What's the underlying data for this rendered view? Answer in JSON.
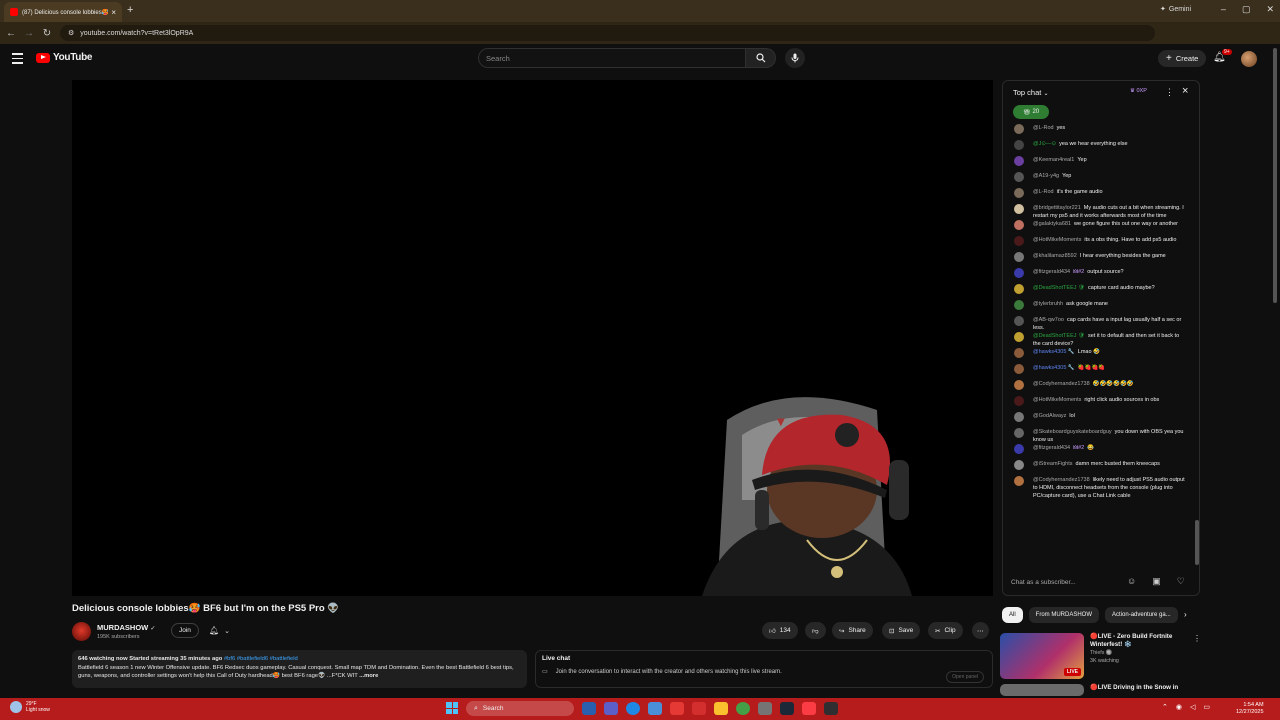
{
  "browser": {
    "tab_title": "(87) Delicious console lobbies🥵",
    "url": "youtube.com/watch?v=tRet3lOpR9A",
    "gemini_label": "Gemini"
  },
  "header": {
    "logo_text": "YouTube",
    "search_placeholder": "Search",
    "create_label": "Create",
    "notifications_count": "9+"
  },
  "video": {
    "title": "Delicious console lobbies🥵 BF6 but I'm on the PS5 Pro 👽",
    "channel_name": "MURDASHOW",
    "verified_icon": "verified-check",
    "subscribers": "195K subscribers",
    "join_label": "Join",
    "likes": "134",
    "share_label": "Share",
    "save_label": "Save",
    "clip_label": "Clip"
  },
  "description": {
    "meta": "646 watching now  Started streaming 35 minutes ago",
    "tags": "#bf6 #battlefield6 #battlefield",
    "text": "Battlefield 6 season 1 new Winter Offensive update. BF6 Redsec duos gameplay. Casual conquest. Small map TDM and Domination. Even the best Battlefield 6 best tips, guns, weapons, and controller settings won't help this Call of Duty hardhead🥵 best BF6 rage👽 ...F*CK WIT",
    "more_label": "...more"
  },
  "livechat_box": {
    "heading": "Live chat",
    "body": "Join the conversation to interact with the creator and others watching this live stream.",
    "open_button": "Open panel"
  },
  "chat": {
    "title": "Top chat",
    "xp_label": "0XP",
    "gift_count": "20",
    "input_placeholder": "Chat as a subscriber...",
    "messages": [
      {
        "author": "@L-Rod",
        "text": "yes",
        "type": "normal",
        "color": "#7a6a5a"
      },
      {
        "author": "@J⊙—⊙",
        "text": "yea we hear everything else",
        "type": "member",
        "color": "#444444"
      },
      {
        "author": "@Keeman4real1",
        "text": "Yep",
        "type": "normal",
        "color": "#6a3fa0"
      },
      {
        "author": "@A19-y4g",
        "text": "Yep",
        "type": "normal",
        "color": "#555555"
      },
      {
        "author": "@L-Rod",
        "text": "it's the game audio",
        "type": "normal",
        "color": "#7a6a5a"
      },
      {
        "author": "@bridgettitaylor221",
        "text": "My audio cuts out a bit when streaming. I restart my ps5 and it works afterwards most of the time",
        "type": "normal",
        "color": "#d0c0a0"
      },
      {
        "author": "@galaktyka681",
        "text": "we gone figure this out one way or another",
        "type": "normal",
        "color": "#c07060"
      },
      {
        "author": "@HotMikeMoments",
        "text": "its a obs thing. Have to add ps5 audio",
        "type": "normal",
        "color": "#4a1a1a"
      },
      {
        "author": "@khalilamaz8592",
        "text": "I hear everything besides the game",
        "type": "normal",
        "color": "#777777"
      },
      {
        "author": "@fitzgerald434",
        "badge": "🜲#2",
        "text": "output source?",
        "type": "normal",
        "color": "#3a3aaa"
      },
      {
        "author": "@DeadShotTEEJ 🛡",
        "text": "capture card audio maybe?",
        "type": "member",
        "color": "#c0a030"
      },
      {
        "author": "@tylerbruhh",
        "text": "ask google mane",
        "type": "normal",
        "color": "#3a7a3a"
      },
      {
        "author": "@AB-qw7oo",
        "text": "cap cards have a input lag usually half a sec or less.",
        "type": "normal",
        "color": "#555555"
      },
      {
        "author": "@DeadShotTEEJ 🛡",
        "text": "set it to default and then set it back to the card device?",
        "type": "member",
        "color": "#c0a030"
      },
      {
        "author": "@hawks4305 🔧",
        "text": "Lmao 🤣",
        "type": "mod",
        "color": "#8a5a3a"
      },
      {
        "author": "@hawks4305 🔧",
        "text": "🍓🍓🍓🍓",
        "type": "mod",
        "color": "#8a5a3a"
      },
      {
        "author": "@Codyhernandez1738",
        "text": "🤣🤣🤣🤣🤣🤣",
        "type": "normal",
        "color": "#b07040"
      },
      {
        "author": "@HotMikeMoments",
        "text": "right click audio sources in obs",
        "type": "normal",
        "color": "#4a1a1a"
      },
      {
        "author": "@GodAlwayz",
        "text": "lol",
        "type": "normal",
        "color": "#777777"
      },
      {
        "author": "@Skateboardguyskateboardguy",
        "text": "you down with OBS yea you know us",
        "type": "normal",
        "color": "#666666"
      },
      {
        "author": "@fitzgerald434",
        "badge": "🜲#2",
        "text": "😂",
        "type": "normal",
        "color": "#3a3aaa"
      },
      {
        "author": "@iStreamFights",
        "text": "damn merc busted them kneecaps",
        "type": "normal",
        "color": "#888888"
      },
      {
        "author": "@Codyhernandez1738",
        "text": "likely need to adjust PS5 audio output to HDMI, disconnect headsets from the console (plug into PC/capture card), use a Chat Link cable",
        "type": "normal",
        "color": "#b07040"
      }
    ]
  },
  "recommendations": {
    "chips": [
      "All",
      "From MURDASHOW",
      "Action-adventure ga..."
    ],
    "items": [
      {
        "title": "🔴LIVE - Zero Build Fortnite Winterfest! ❄️",
        "channel": "Thiefs 🔘",
        "stats": "3K watching",
        "live_label": "LIVE"
      },
      {
        "title": "🔴LIVE Driving in the Snow in",
        "channel": "",
        "stats": "",
        "live_label": ""
      }
    ]
  },
  "taskbar": {
    "weather_temp": "29°F",
    "weather_desc": "Light snow",
    "search_label": "Search",
    "time": "1:54 AM",
    "date": "12/27/2025"
  },
  "colors": {
    "accent_red": "#ff0000",
    "link_blue": "#3ea6ff",
    "taskbar": "#b71c1c"
  }
}
